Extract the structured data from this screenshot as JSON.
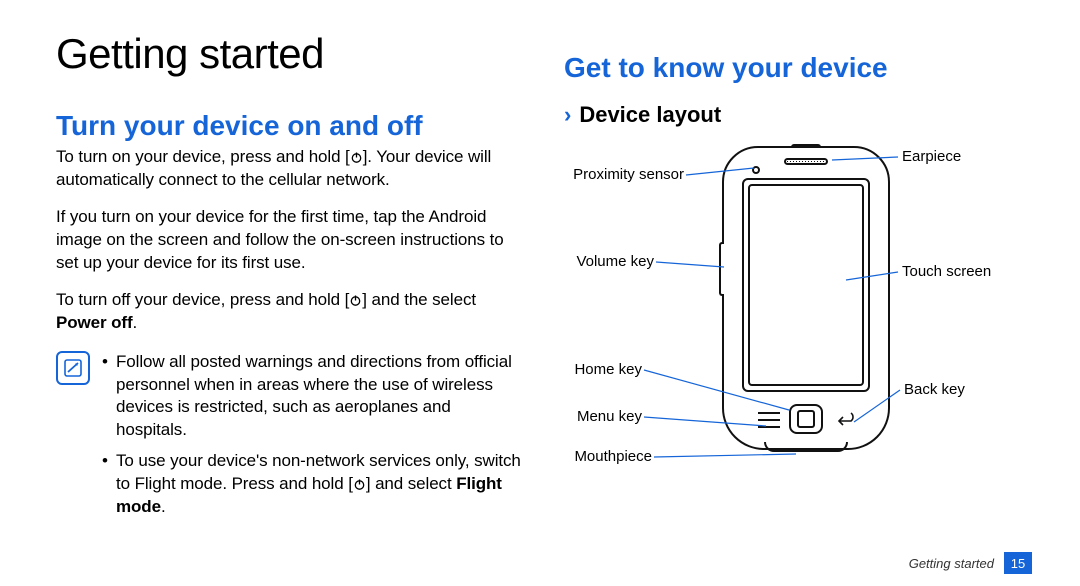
{
  "chapter_title": "Getting started",
  "left": {
    "section_title": "Turn your device on and off",
    "para1_pre": "To turn on your device, press and hold [",
    "para1_post": "]. Your device will automatically connect to the cellular network.",
    "para2": "If you turn on your device for the first time, tap the Android image on the screen and follow the on-screen instructions to set up your device for its first use.",
    "para3_pre": "To turn off your device, press and hold [",
    "para3_post": "] and the select ",
    "para3_bold": "Power off",
    "para3_end": ".",
    "notes": {
      "item1": "Follow all posted warnings and directions from official personnel when in areas where the use of wireless devices is restricted, such as aeroplanes and hospitals.",
      "item2_pre": "To use your device's non-network services only, switch to Flight mode. Press and hold [",
      "item2_post": "] and select ",
      "item2_bold": "Flight mode",
      "item2_end": "."
    }
  },
  "right": {
    "section_title": "Get to know your device",
    "sub_title": "Device layout",
    "labels": {
      "proximity_sensor": "Proximity sensor",
      "earpiece": "Earpiece",
      "volume_key": "Volume key",
      "touch_screen": "Touch screen",
      "home_key": "Home key",
      "back_key": "Back key",
      "menu_key": "Menu key",
      "mouthpiece": "Mouthpiece"
    }
  },
  "footer": {
    "section_name": "Getting started",
    "page_number": "15"
  }
}
